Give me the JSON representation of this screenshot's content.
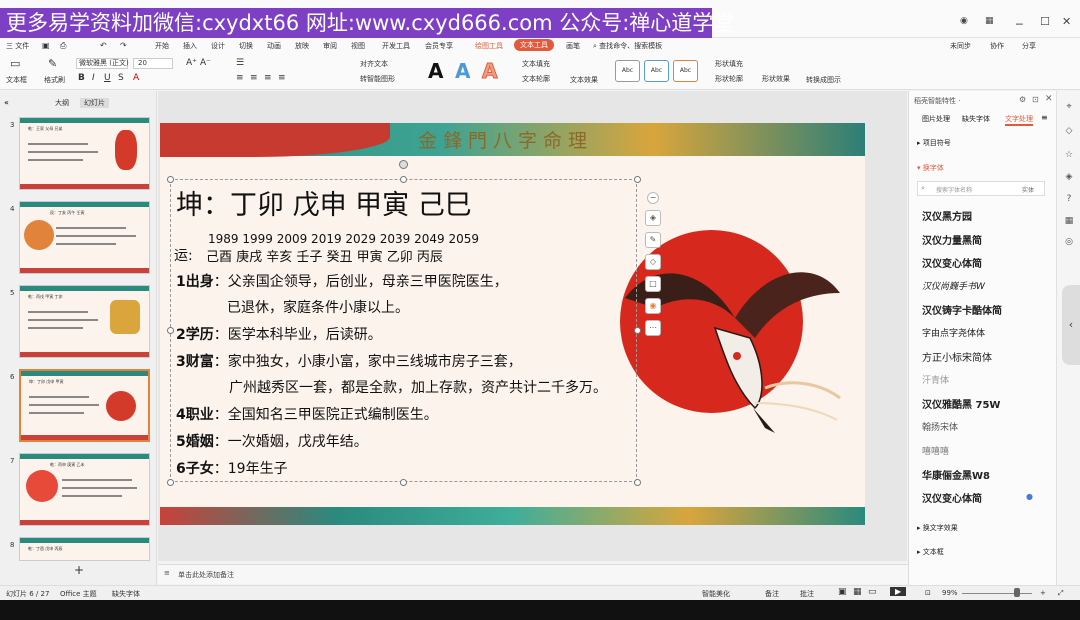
{
  "banner": "更多易学资料加微信:cxydxt66 网址:www.cxyd666.com 公众号:禅心道学堂",
  "menubar": {
    "file": "三 文件",
    "items": [
      "开始",
      "插入",
      "设计",
      "切换",
      "动画",
      "放映",
      "审阅",
      "视图",
      "开发工具",
      "会员专享",
      "绘图工具",
      "文本工具",
      "画笔"
    ],
    "search": "查找命令、搜索模板",
    "unsynced": "未同步",
    "collab": "协作",
    "share": "分享"
  },
  "ribbon": {
    "textbox": "文本框",
    "format_painter": "格式刷",
    "font": "微软雅黑 (正文)",
    "size": "20",
    "align_text": "对齐文本",
    "to_smartart": "转智能图形",
    "text_fill": "文本填充",
    "text_outline": "文本轮廓",
    "text_effect": "文本效果",
    "style_abc": "Abc",
    "shape_fill": "形状填充",
    "shape_outline": "形状轮廓",
    "shape_effect": "形状效果",
    "arrange": "转换成图示"
  },
  "leftpanel": {
    "tab_outline": "大纲",
    "tab_slides": "幻灯片",
    "slide_numbers": [
      "3",
      "4",
      "5",
      "6",
      "7",
      "8"
    ],
    "thumb_titles": [
      "乾：王家 父母 兄弟",
      "艮：丁亥 丙午 壬寅",
      "乾：丙戌 甲寅 丁卯",
      "坤：丁卯 戊申 甲寅",
      "乾：丙申 庚寅 乙未",
      "乾：丁酉 戊申 丙辰"
    ],
    "add": "+"
  },
  "slide": {
    "header_deco": "金鋒門八字命理",
    "title": "坤：丁卯 戊申 甲寅 己巳",
    "years": "1989 1999 2009 2019 2029 2039 2049 2059",
    "yun_label": "运:",
    "yun_values": "己酉 庚戌 辛亥 壬子 癸丑 甲寅 乙卯 丙辰",
    "items": [
      {
        "num": "1",
        "label": "出身",
        "lines": [
          "：父亲国企领导，后创业，母亲三甲医院医生，",
          "已退休，家庭条件小康以上。"
        ]
      },
      {
        "num": "2",
        "label": "学历",
        "lines": [
          "：医学本科毕业，后读研。"
        ]
      },
      {
        "num": "3",
        "label": "财富",
        "lines": [
          "：家中独女，小康小富，家中三线城市房子三套，",
          "广州越秀区一套，都是全款，加上存款，资产共计二千多万。"
        ]
      },
      {
        "num": "4",
        "label": "职业",
        "lines": [
          "：全国知名三甲医院正式编制医生。"
        ]
      },
      {
        "num": "5",
        "label": "婚姻",
        "lines": [
          "：一次婚姻，戊戌年结。"
        ]
      },
      {
        "num": "6",
        "label": "子女",
        "lines": [
          "：19年生子"
        ]
      }
    ]
  },
  "notes_placeholder": "单击此处添加备注",
  "rightpanel": {
    "title": "稻壳智能特性 ·",
    "tabs": [
      "图片处理",
      "缺失字体",
      "文字处理"
    ],
    "section_project": "项目符号",
    "section_font": "换字体",
    "search_placeholder": "搜索字体名称",
    "search_btn": "实体",
    "fonts": [
      "汉仪黑方园",
      "汉仪力量黑简",
      "汉仪变心体简",
      "汉仪尚巍手书W",
      "汉仪铸字卡酷体简",
      "字由点字尧体体",
      "方正小标宋简体",
      "汗青体",
      "汉仪雅酷黑 75W",
      "翰扬宋体",
      "嘻嘻嘻",
      "华康俪金黑W8",
      "汉仪变心体简"
    ],
    "section_art": "换文字效果",
    "section_textbox": "文本框"
  },
  "status": {
    "slide_pos": "幻灯片 6 / 27",
    "theme": "Office 主题",
    "missing_font": "缺失字体",
    "smart_beauty": "智能美化",
    "notes": "备注",
    "comments": "批注",
    "zoom": "99%"
  },
  "colors": {
    "banner": "#7d3fc4",
    "accent": "#e25a3c",
    "sun": "#d6281c",
    "teal": "#2f8d7f"
  }
}
